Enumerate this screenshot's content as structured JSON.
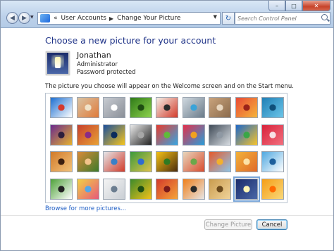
{
  "address_bar": {
    "crumbs": [
      "User Accounts",
      "Change Your Picture"
    ],
    "prefix": "«"
  },
  "search": {
    "placeholder": "Search Control Panel"
  },
  "main": {
    "heading": "Choose a new picture for your account",
    "user": {
      "name": "Jonathan",
      "role": "Administrator",
      "protection": "Password protected"
    },
    "info_text": "The picture you choose will appear on the Welcome screen and on the Start menu.",
    "browse_link": "Browse for more pictures..."
  },
  "pictures": [
    {
      "name": "ferris-wheel",
      "colors": [
        "#1d6fd1",
        "#ffffff",
        "#d43a2f"
      ]
    },
    {
      "name": "starfish",
      "colors": [
        "#d9c3a3",
        "#e07a3a",
        "#f0e2c8"
      ]
    },
    {
      "name": "robot",
      "colors": [
        "#c8ccd2",
        "#8a8f98",
        "#ffffff"
      ]
    },
    {
      "name": "leaf",
      "colors": [
        "#2f7a18",
        "#8dd34c",
        "#1f4d12"
      ]
    },
    {
      "name": "lucky-cat",
      "colors": [
        "#f3efe7",
        "#d33a2a",
        "#2b2b2b"
      ]
    },
    {
      "name": "compass",
      "colors": [
        "#cfd8df",
        "#6a7b8a",
        "#3aa3d8"
      ]
    },
    {
      "name": "kitten",
      "colors": [
        "#c9a37c",
        "#8a6a4c",
        "#e8d6bf"
      ]
    },
    {
      "name": "flower-red",
      "colors": [
        "#e84a36",
        "#f6b53b",
        "#9b2319"
      ]
    },
    {
      "name": "ferns",
      "colors": [
        "#1f7fb6",
        "#6bc5e8",
        "#0f4f7a"
      ]
    },
    {
      "name": "ball",
      "colors": [
        "#6a2a8c",
        "#e5b12f",
        "#2e1e3c"
      ]
    },
    {
      "name": "fabric",
      "colors": [
        "#c7402d",
        "#e8a235",
        "#8a2c86"
      ]
    },
    {
      "name": "fish",
      "colors": [
        "#1b4f9c",
        "#f6c51c",
        "#0b2b5c"
      ]
    },
    {
      "name": "dog",
      "colors": [
        "#e9e9e9",
        "#222222",
        "#a7a7a7"
      ]
    },
    {
      "name": "crayons",
      "colors": [
        "#e63b2e",
        "#37a6e2",
        "#5fbb3a"
      ]
    },
    {
      "name": "beads",
      "colors": [
        "#e3304b",
        "#2a9ed9",
        "#f2a11f"
      ]
    },
    {
      "name": "shell",
      "colors": [
        "#3f4a57",
        "#d8dde2",
        "#8e98a3"
      ]
    },
    {
      "name": "windows",
      "colors": [
        "#1e68c8",
        "#f6c42c",
        "#3aa646"
      ]
    },
    {
      "name": "origami",
      "colors": [
        "#d8233b",
        "#f26f7e",
        "#f7e0e4"
      ]
    },
    {
      "name": "guitar",
      "colors": [
        "#d17a2a",
        "#f2c27a",
        "#3c1f0f"
      ]
    },
    {
      "name": "puppy",
      "colors": [
        "#d98b3a",
        "#3d7a2a",
        "#f2c38a"
      ]
    },
    {
      "name": "toy-robot",
      "colors": [
        "#e4e7ea",
        "#d23b2a",
        "#3a80c8"
      ]
    },
    {
      "name": "hammock",
      "colors": [
        "#3b9a3c",
        "#e0c24a",
        "#2f6bd1"
      ]
    },
    {
      "name": "sunflower",
      "colors": [
        "#f5c215",
        "#4b2c0d",
        "#2f7a22"
      ]
    },
    {
      "name": "pencils",
      "colors": [
        "#e7d6bc",
        "#d94c2f",
        "#6ba84a"
      ]
    },
    {
      "name": "balloon",
      "colors": [
        "#e45a2a",
        "#8ec5e8",
        "#f2b02e"
      ]
    },
    {
      "name": "snail",
      "colors": [
        "#f2b23a",
        "#e06a2a",
        "#fce2a8"
      ]
    },
    {
      "name": "sailboat",
      "colors": [
        "#4fa8e0",
        "#ffffff",
        "#1c5f9c"
      ]
    },
    {
      "name": "soccer-ball",
      "colors": [
        "#4fa23a",
        "#ffffff",
        "#222222"
      ]
    },
    {
      "name": "chalk",
      "colors": [
        "#f2d045",
        "#e65a7a",
        "#55a7e6"
      ]
    },
    {
      "name": "marbles",
      "colors": [
        "#f4f4f4",
        "#c9ced4",
        "#6b7d90"
      ]
    },
    {
      "name": "window-frame",
      "colors": [
        "#3c8a2a",
        "#f2c11a",
        "#1f4f14"
      ]
    },
    {
      "name": "textile",
      "colors": [
        "#d33a2a",
        "#f5a43a",
        "#7a1a1a"
      ]
    },
    {
      "name": "butterfly",
      "colors": [
        "#f07f1a",
        "#e6e6e6",
        "#2a2a2a"
      ]
    },
    {
      "name": "ammonite",
      "colors": [
        "#c99c4e",
        "#f0d39a",
        "#6b4a1c"
      ]
    },
    {
      "name": "lighthouse",
      "colors": [
        "#1b2c6a",
        "#4a67a8",
        "#fff5b5"
      ]
    },
    {
      "name": "gerbera",
      "colors": [
        "#f59e16",
        "#f9d87a",
        "#ff6a00"
      ]
    }
  ],
  "selected_picture": "lighthouse",
  "buttons": {
    "change": "Change Picture",
    "cancel": "Cancel"
  }
}
